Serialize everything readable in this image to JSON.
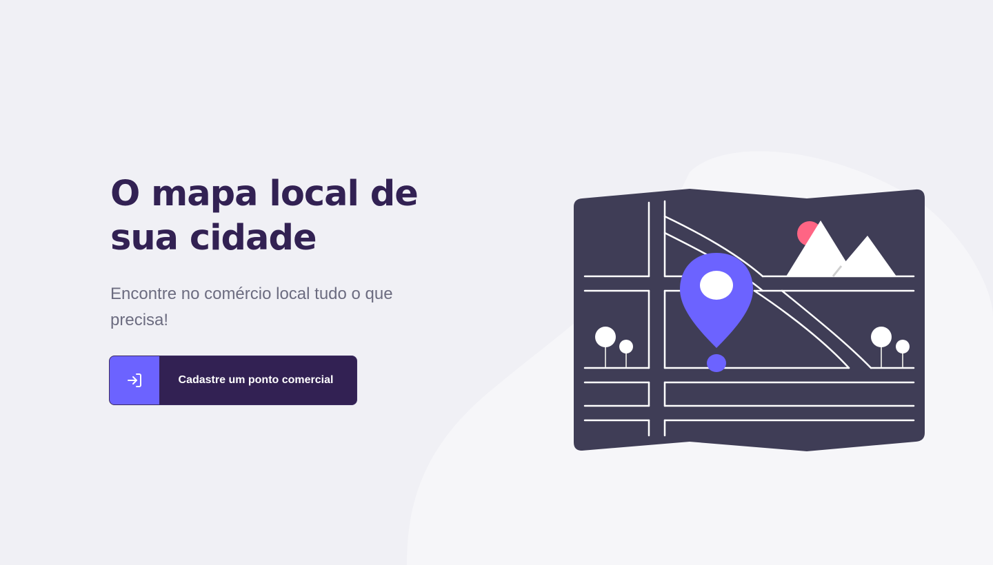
{
  "hero": {
    "title_line1": "O mapa local de",
    "title_line2": "sua cidade",
    "subtitle": "Encontre no comércio local tudo o que precisa!"
  },
  "cta": {
    "label": "Cadastre um ponto comercial",
    "icon": "log-in-icon"
  },
  "illustration": {
    "name": "folded-city-map",
    "icons": [
      "location-pin-icon",
      "mountain-icon",
      "sun-icon",
      "tree-icon"
    ]
  },
  "colors": {
    "background": "#f0f0f5",
    "title": "#322153",
    "text": "#6c6c80",
    "button": "#322153",
    "accent": "#6c63ff",
    "map": "#3f3d56",
    "sun": "#ff6584"
  }
}
